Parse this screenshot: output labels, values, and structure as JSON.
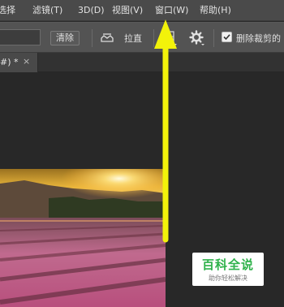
{
  "menubar": {
    "items": [
      "选择",
      "滤镜(T)",
      "3D(D)",
      "视图(V)",
      "窗口(W)",
      "帮助(H)"
    ]
  },
  "options": {
    "clear_label": "清除",
    "straighten_label": "拉直",
    "delete_cropped_label": "删除裁剪的"
  },
  "tab": {
    "label": "#) *",
    "close": "×"
  },
  "watermark": {
    "main": "百科全说",
    "sub": "助你轻松解决"
  },
  "colors": {
    "arrow": "#f2f20a",
    "watermark_green": "#2fb24b"
  }
}
